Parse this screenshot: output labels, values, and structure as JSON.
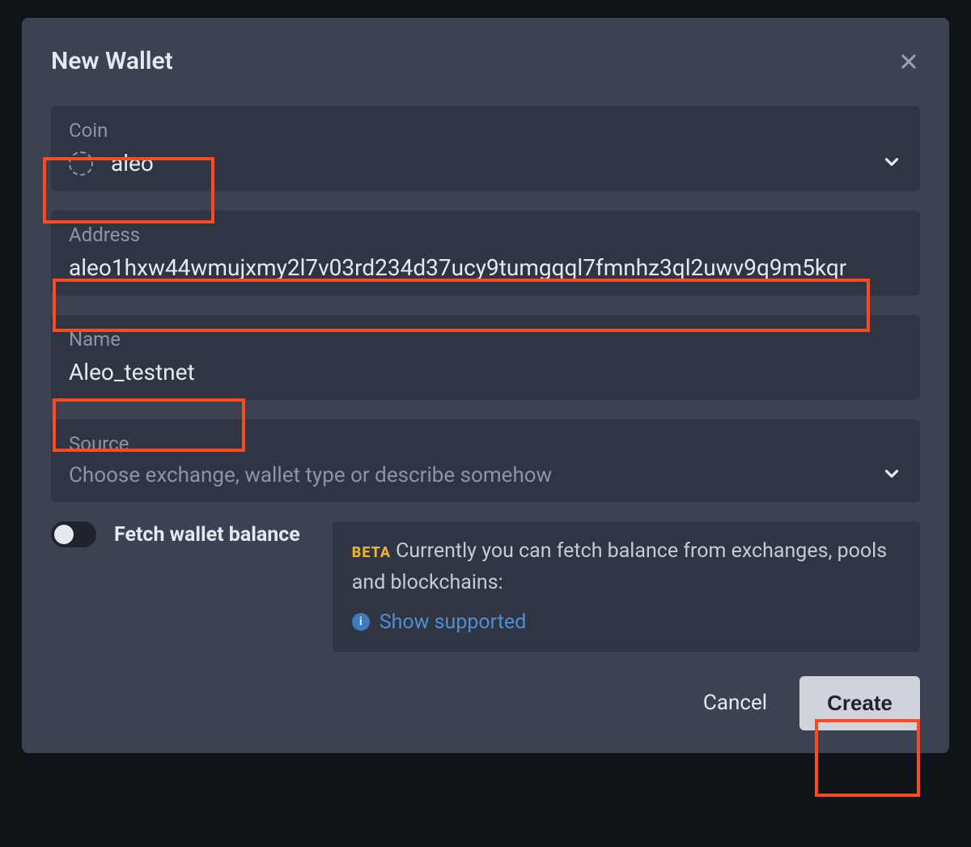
{
  "modal": {
    "title": "New Wallet",
    "fields": {
      "coin": {
        "label": "Coin",
        "value": "aleo"
      },
      "address": {
        "label": "Address",
        "value": "aleo1hxw44wmujxmy2l7v03rd234d37ucy9tumgqql7fmnhz3ql2uwv9q9m5kqr"
      },
      "name": {
        "label": "Name",
        "value": "Aleo_testnet"
      },
      "source": {
        "label": "Source",
        "placeholder": "Choose exchange, wallet type or describe somehow"
      }
    },
    "toggle": {
      "label": "Fetch wallet balance",
      "on": false
    },
    "info": {
      "badge": "BETA",
      "text": "Currently you can fetch balance from exchanges, pools and blockchains:",
      "link": "Show supported"
    },
    "footer": {
      "cancel": "Cancel",
      "create": "Create"
    }
  }
}
